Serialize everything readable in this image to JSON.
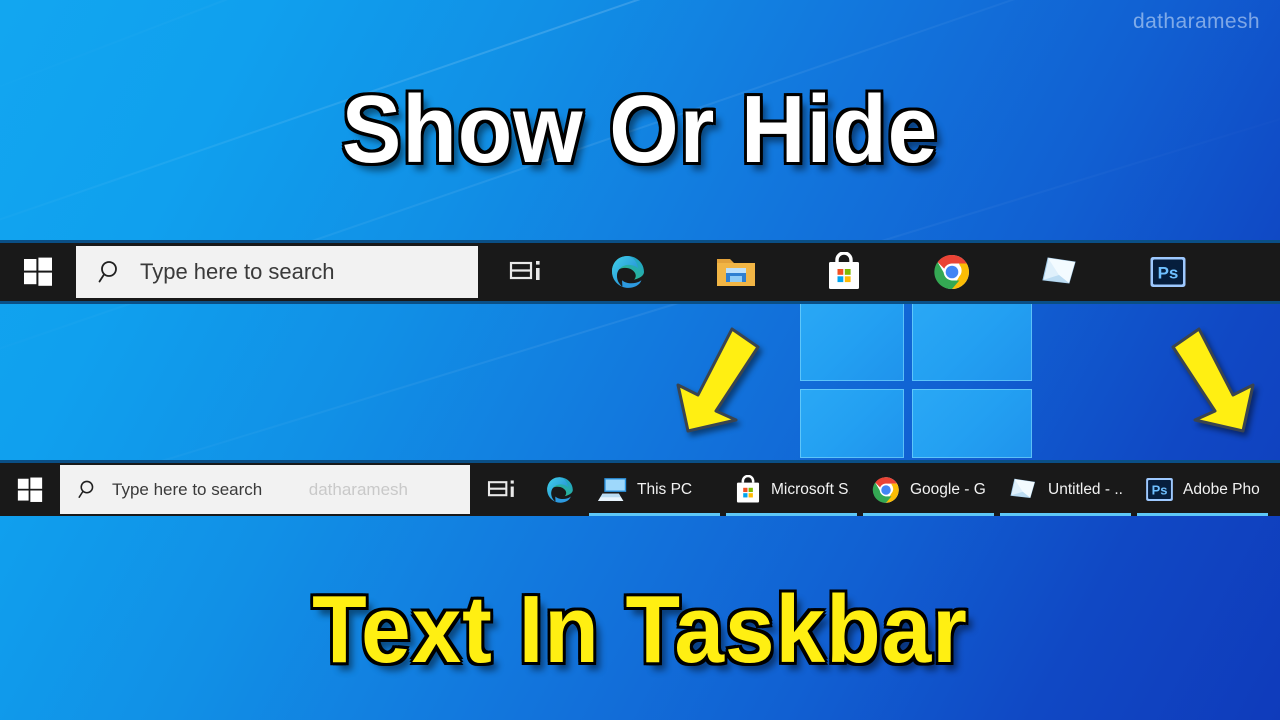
{
  "watermark": "datharamesh",
  "titles": {
    "top": "Show Or Hide",
    "bottom": "Text In Taskbar"
  },
  "colors": {
    "taskbar_bg": "#191919",
    "search_bg": "#f2f2f2",
    "title_top_color": "#ffffff",
    "title_bottom_color": "#ffef12",
    "arrow_color": "#ffef12",
    "indicator_color": "#5ec8f7",
    "wallpaper_from": "#12a6f0",
    "wallpaper_to": "#0f3bbb"
  },
  "taskbar_icons_hidden": {
    "start_label": "Start",
    "start_icon": "windows-logo-icon",
    "search_placeholder": "Type here to search",
    "search_icon": "search-icon",
    "task_view_label": "Task View",
    "task_view_icon": "task-view-icon",
    "apps": [
      {
        "icon": "microsoft-edge-icon",
        "name": "Microsoft Edge"
      },
      {
        "icon": "file-explorer-icon",
        "name": "File Explorer"
      },
      {
        "icon": "microsoft-store-icon",
        "name": "Microsoft Store"
      },
      {
        "icon": "google-chrome-icon",
        "name": "Google Chrome"
      },
      {
        "icon": "sticky-notes-icon",
        "name": "Sticky Notes"
      },
      {
        "icon": "adobe-photoshop-icon",
        "name": "Adobe Photoshop"
      }
    ]
  },
  "taskbar_labels_shown": {
    "start_label": "Start",
    "start_icon": "windows-logo-icon",
    "search_placeholder": "Type here to search",
    "search_watermark": "datharamesh",
    "search_icon": "search-icon",
    "task_view_label": "Task View",
    "task_view_icon": "task-view-icon",
    "apps": [
      {
        "icon": "microsoft-edge-icon",
        "label": "",
        "running": false
      },
      {
        "icon": "this-pc-icon",
        "label": "This PC",
        "running": true
      },
      {
        "icon": "microsoft-store-icon",
        "label": "Microsoft S...",
        "running": true
      },
      {
        "icon": "google-chrome-icon",
        "label": "Google - G...",
        "running": true
      },
      {
        "icon": "sticky-notes-icon",
        "label": "Untitled - ...",
        "running": true
      },
      {
        "icon": "adobe-photoshop-icon",
        "label": "Adobe Pho...",
        "running": true
      }
    ]
  },
  "annotations": [
    {
      "name": "arrow-left",
      "points": "down-left"
    },
    {
      "name": "arrow-right",
      "points": "down-right"
    }
  ]
}
